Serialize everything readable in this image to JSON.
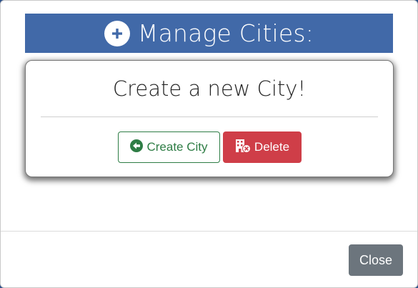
{
  "header": {
    "title": "Manage Cities:",
    "icon": "plus-circle-icon",
    "background_color": "#4169a8"
  },
  "card": {
    "title": "Create a new City!",
    "create_button": {
      "label": "Create City",
      "icon": "arrow-left-circle-icon",
      "color": "#2e7d45"
    },
    "delete_button": {
      "label": "Delete",
      "icon": "building-delete-icon",
      "color": "#cf3e48"
    }
  },
  "footer": {
    "close_button": {
      "label": "Close",
      "color": "#6c757d"
    }
  }
}
